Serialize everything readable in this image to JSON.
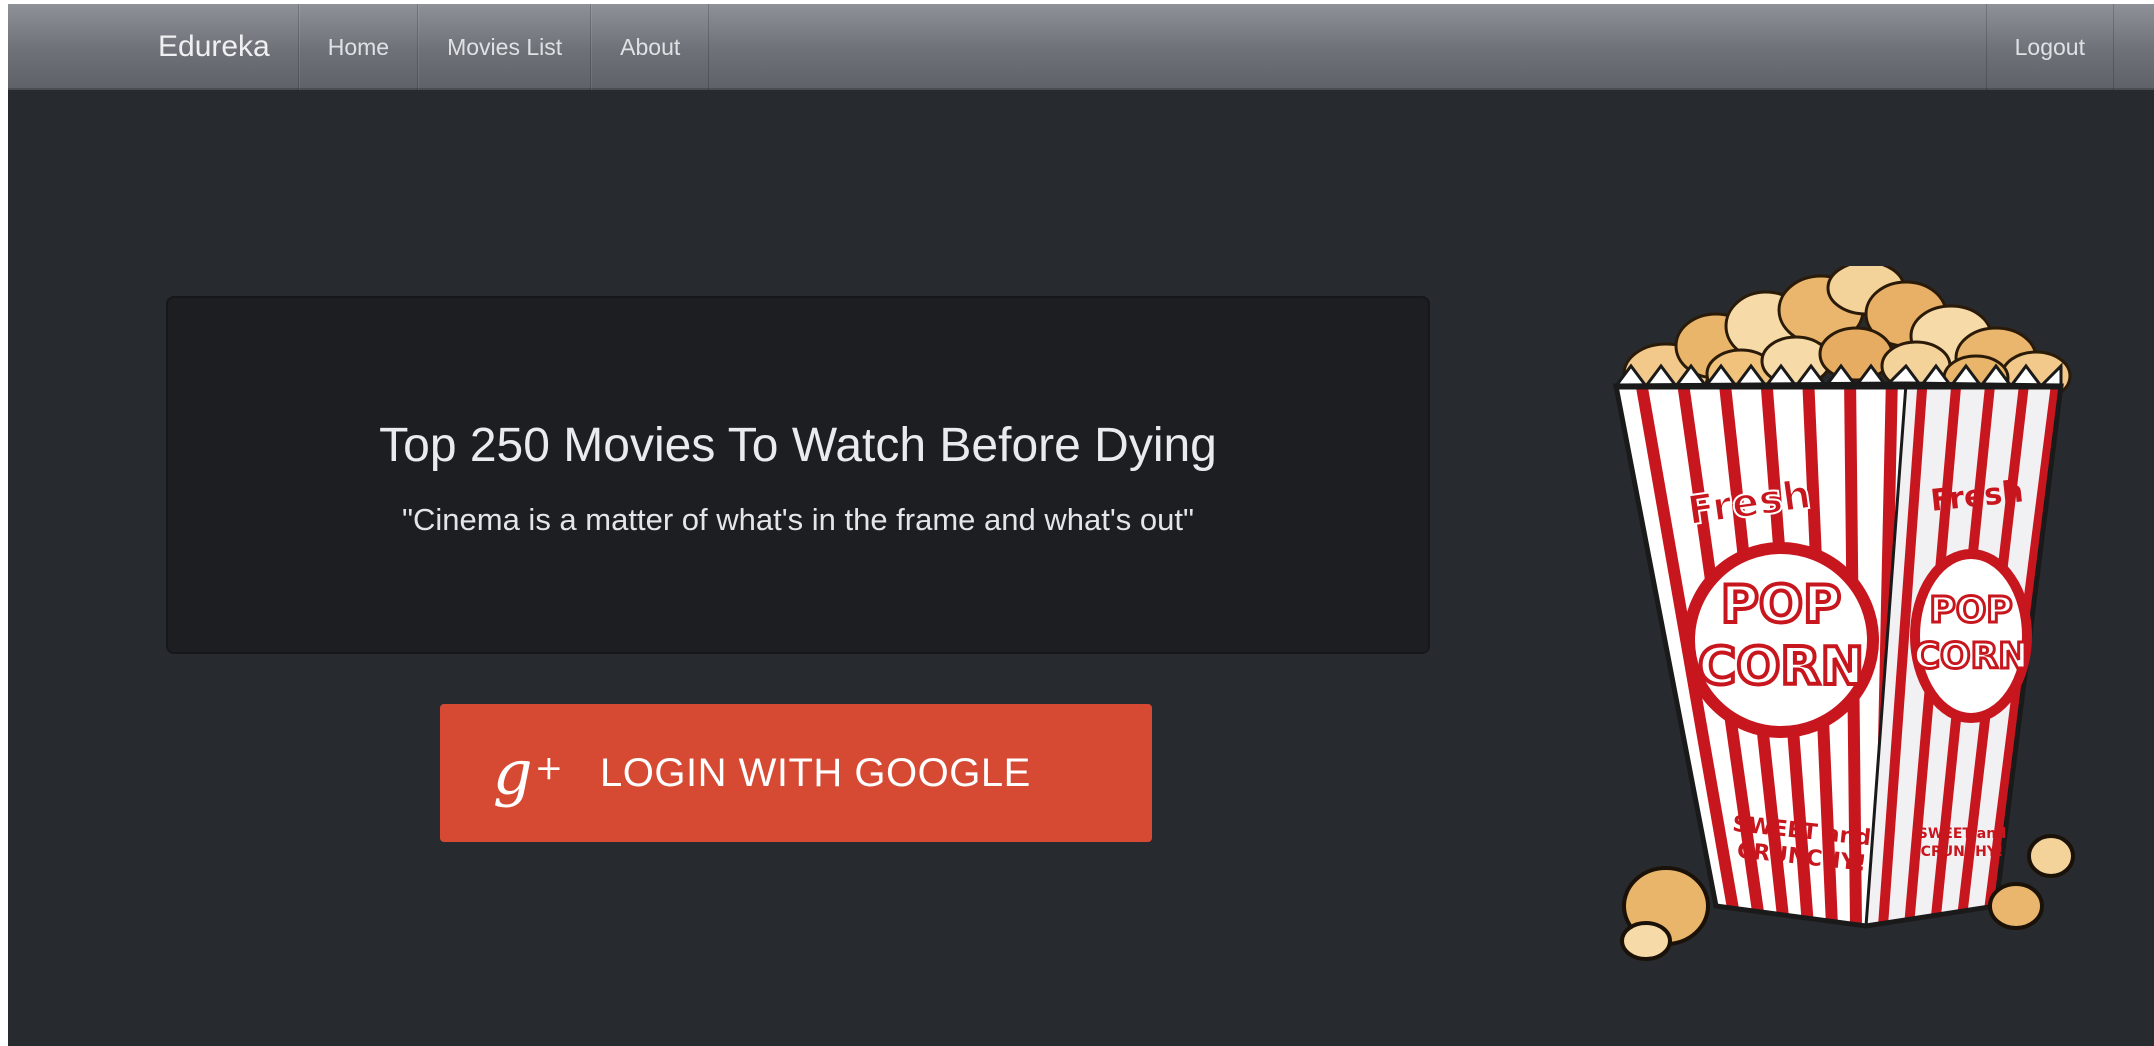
{
  "navbar": {
    "brand": "Edureka",
    "links": [
      {
        "label": "Home"
      },
      {
        "label": "Movies List"
      },
      {
        "label": "About"
      }
    ],
    "logout_label": "Logout"
  },
  "jumbotron": {
    "title": "Top 250 Movies To Watch Before Dying",
    "quote": "\"Cinema is a matter of what's in the frame and what's out\""
  },
  "login_button": {
    "icon": "google-plus-icon",
    "label": "LOGIN WITH GOOGLE"
  },
  "popcorn": {
    "fresh": "Fresh",
    "pop": "POP",
    "corn": "CORN",
    "sweet": "SWEET and",
    "crunchy": "CRUNCHY!"
  },
  "colors": {
    "background": "#272a2f",
    "jumbotron": "#1c1e21",
    "google_red": "#d64a34",
    "popcorn_red": "#c8161e"
  }
}
